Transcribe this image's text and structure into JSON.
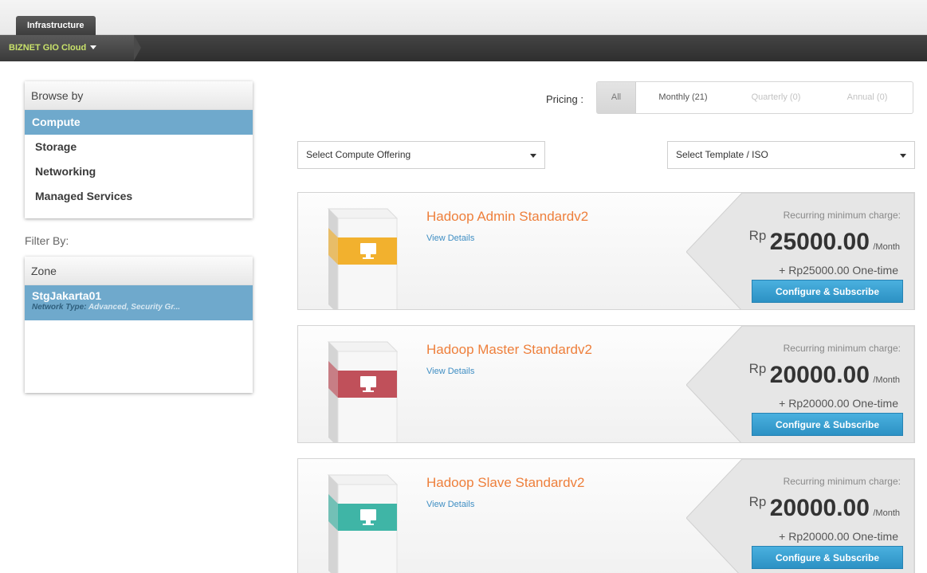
{
  "header": {
    "tab_label": "Infrastructure",
    "brand_label": "BIZNET GIO Cloud"
  },
  "sidebar": {
    "browse_title": "Browse by",
    "items": [
      {
        "label": "Compute",
        "active": true
      },
      {
        "label": "Storage",
        "active": false
      },
      {
        "label": "Networking",
        "active": false
      },
      {
        "label": "Managed Services",
        "active": false
      }
    ],
    "filter_label": "Filter By:",
    "zone_title": "Zone",
    "zone": {
      "name": "StgJakarta01",
      "network_label": "Network Type:",
      "network_value": "Advanced, Security Gr..."
    }
  },
  "pricing": {
    "label": "Pricing :",
    "options": [
      "All",
      "Monthly (21)",
      "Quarterly (0)",
      "Annual (0)"
    ]
  },
  "selects": {
    "offering": "Select Compute Offering",
    "template": "Select Template / ISO"
  },
  "products": [
    {
      "title": "Hadoop Admin Standardv2",
      "link": "View Details",
      "recurring_label": "Recurring minimum charge:",
      "currency": "Rp",
      "amount": "25000.00",
      "unit": "/Month",
      "onetime": "+ Rp25000.00 One-time",
      "button": "Configure & Subscribe",
      "color": "#f2b12e"
    },
    {
      "title": "Hadoop Master Standardv2",
      "link": "View Details",
      "recurring_label": "Recurring minimum charge:",
      "currency": "Rp",
      "amount": "20000.00",
      "unit": "/Month",
      "onetime": "+ Rp20000.00 One-time",
      "button": "Configure & Subscribe",
      "color": "#c0505a"
    },
    {
      "title": "Hadoop Slave Standardv2",
      "link": "View Details",
      "recurring_label": "Recurring minimum charge:",
      "currency": "Rp",
      "amount": "20000.00",
      "unit": "/Month",
      "onetime": "+ Rp20000.00 One-time",
      "button": "Configure & Subscribe",
      "color": "#3fb5a6"
    }
  ]
}
